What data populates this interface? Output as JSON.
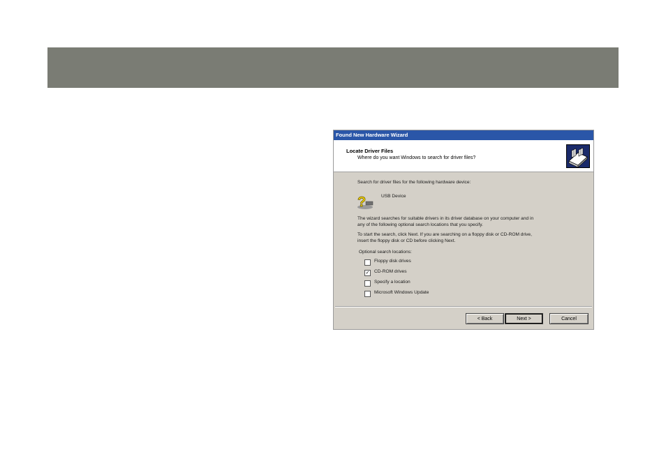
{
  "window": {
    "title": "Found New Hardware Wizard"
  },
  "header": {
    "title": "Locate Driver Files",
    "subtitle": "Where do you want Windows to search for driver files?"
  },
  "body": {
    "intro": "Search for driver files for the following hardware device:",
    "device_name": "USB Device",
    "para1_line1": "The wizard searches for suitable drivers in its driver database on your computer and in",
    "para1_line2": "any of the following optional search locations that you specify.",
    "para2_line1": "To start the search, click Next. If you are searching on a floppy disk or CD-ROM drive,",
    "para2_line2": "insert the floppy disk or CD before clicking Next.",
    "options_heading": "Optional search locations:"
  },
  "options": [
    {
      "label": "Floppy disk drives",
      "checked": false
    },
    {
      "label": "CD-ROM drives",
      "checked": true
    },
    {
      "label": "Specify a location",
      "checked": false
    },
    {
      "label": "Microsoft Windows Update",
      "checked": false
    }
  ],
  "buttons": {
    "back": "< Back",
    "next": "Next >",
    "cancel": "Cancel"
  },
  "icons": {
    "header": "hardware-wizard-icon",
    "device": "unknown-device-icon",
    "check": "✓"
  },
  "colors": {
    "banner": "#7a7c74",
    "titlebar": "#2a56a8",
    "dialog_bg": "#d4d0c8"
  }
}
